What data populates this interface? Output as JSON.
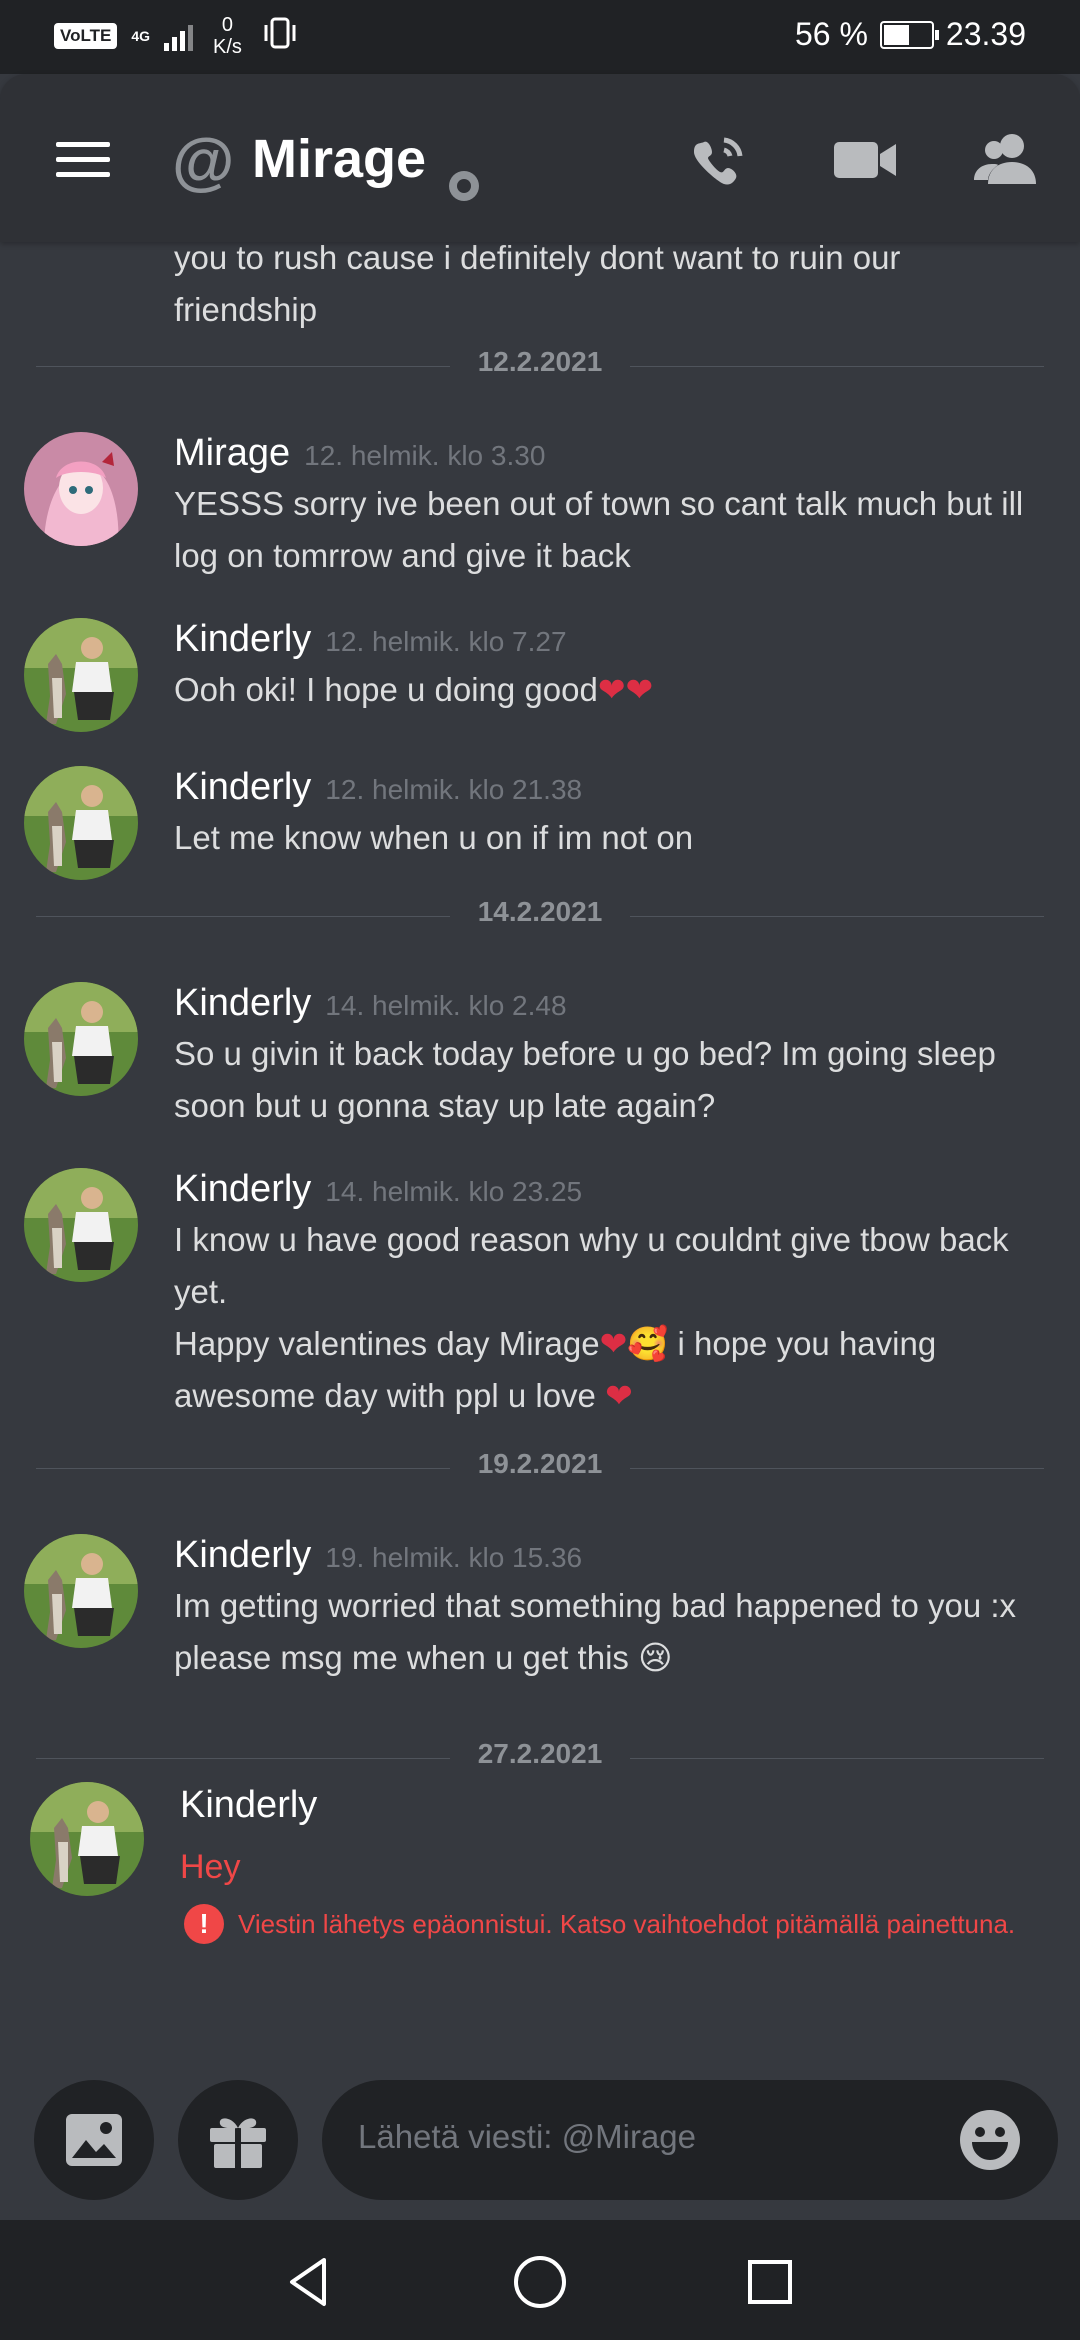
{
  "status_bar": {
    "volte": "VoLTE",
    "network": "4G",
    "speed_value": "0",
    "speed_unit": "K/s",
    "battery_percent": "56 %",
    "battery_level": 0.56,
    "time": "23.39"
  },
  "header": {
    "at_symbol": "@",
    "title": "Mirage",
    "icons": [
      "menu-icon",
      "call-icon",
      "video-icon",
      "members-icon"
    ]
  },
  "messages": {
    "continued_text": "you to rush cause i definitely dont want to ruin our friendship",
    "dividers": [
      "12.2.2021",
      "14.2.2021",
      "19.2.2021",
      "27.2.2021"
    ],
    "items": [
      {
        "author": "Mirage",
        "timestamp": "12. helmik. klo 3.30",
        "lines": [
          "YESSS sorry ive been out of town so cant talk much but ill log on tomrrow and give it back"
        ]
      },
      {
        "author": "Kinderly",
        "timestamp": "12. helmik. klo 7.27",
        "lines": [
          "Ooh oki! I hope u doing good",
          "❤❤"
        ]
      },
      {
        "author": "Kinderly",
        "timestamp": "12. helmik. klo 21.38",
        "lines": [
          "Let me know when u on if im not on"
        ]
      },
      {
        "author": "Kinderly",
        "timestamp": "14. helmik. klo 2.48",
        "lines": [
          "So u givin it back today before u go bed? Im going sleep soon but u gonna stay up late again?"
        ]
      },
      {
        "author": "Kinderly",
        "timestamp": "14. helmik. klo 23.25",
        "lines": [
          "I know u have good reason why u couldnt give tbow back yet.",
          "Happy valentines day Mirage",
          "❤🥰",
          " i hope you having awesome day with ppl u love ",
          "❤"
        ]
      },
      {
        "author": "Kinderly",
        "timestamp": "19. helmik. klo 15.36",
        "lines": [
          "Im getting worried that something bad happened to you :x please msg me when u get this ",
          "😢"
        ]
      }
    ],
    "failed": {
      "author": "Kinderly",
      "text": "Hey",
      "error": "Viestin lähetys epäonnistui. Katso vaihtoehdot pitämällä painettuna.",
      "error_icon": "!"
    }
  },
  "input": {
    "placeholder": "Lähetä viesti: @Mirage",
    "buttons": [
      "image-icon",
      "gift-icon",
      "emoji-icon"
    ]
  },
  "nav": [
    "back-icon",
    "home-icon",
    "recents-icon"
  ]
}
